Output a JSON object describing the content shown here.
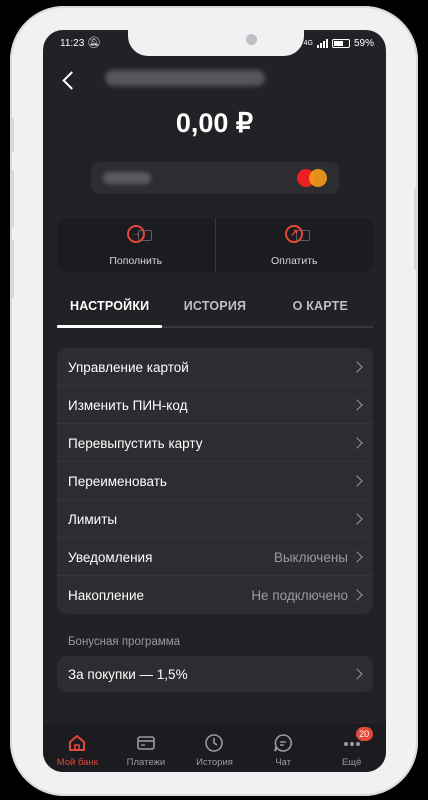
{
  "status_bar": {
    "time": "11:23",
    "network": "4G",
    "battery": "59%"
  },
  "header": {
    "balance": "0,00 ₽"
  },
  "actions": {
    "topup": "Пополнить",
    "pay": "Оплатить"
  },
  "tabs": [
    "НАСТРОЙКИ",
    "ИСТОРИЯ",
    "О КАРТЕ"
  ],
  "settings": [
    {
      "label": "Управление картой",
      "value": ""
    },
    {
      "label": "Изменить ПИН-код",
      "value": ""
    },
    {
      "label": "Перевыпустить карту",
      "value": ""
    },
    {
      "label": "Переименовать",
      "value": ""
    },
    {
      "label": "Лимиты",
      "value": ""
    },
    {
      "label": "Уведомления",
      "value": "Выключены"
    },
    {
      "label": "Накопление",
      "value": "Не подключено"
    }
  ],
  "bonus": {
    "section_title": "Бонусная программа",
    "item": "За покупки — 1,5%"
  },
  "nav": {
    "items": [
      "Мой банк",
      "Платежи",
      "История",
      "Чат",
      "Ещё"
    ],
    "more_badge": "20"
  },
  "colors": {
    "accent": "#e3483a",
    "screen_bg": "#222226",
    "card_bg": "#2c2c31"
  },
  "icons": [
    "back-arrow-icon",
    "mastercard-icon",
    "topup-icon",
    "pay-icon",
    "chevron-right-icon",
    "home-icon",
    "card-icon",
    "clock-icon",
    "chat-icon",
    "more-dots-icon"
  ]
}
